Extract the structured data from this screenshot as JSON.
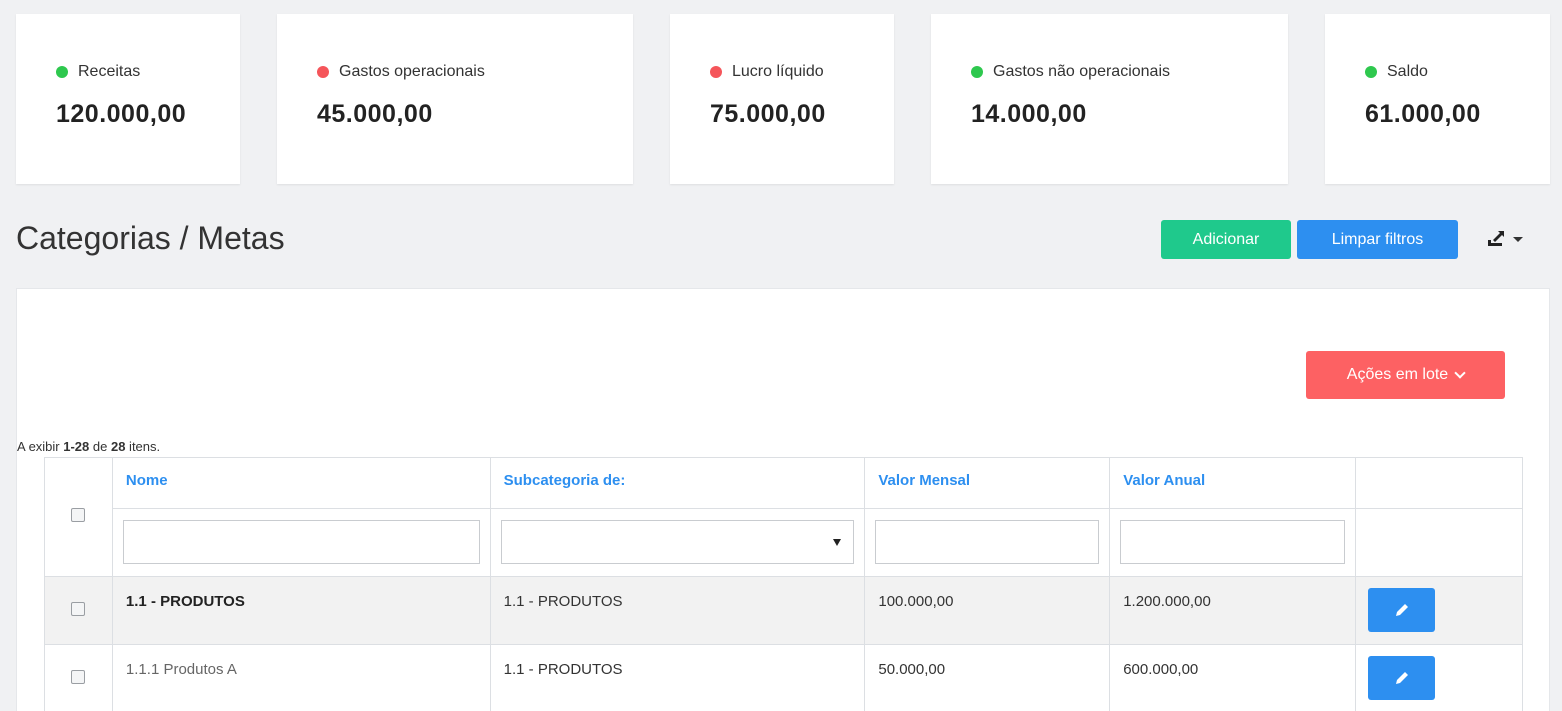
{
  "cards": [
    {
      "label": "Receitas",
      "value": "120.000,00",
      "dot": "#2ec84e"
    },
    {
      "label": "Gastos operacionais",
      "value": "45.000,00",
      "dot": "#f5555a"
    },
    {
      "label": "Lucro líquido",
      "value": "75.000,00",
      "dot": "#f5555a"
    },
    {
      "label": "Gastos não operacionais",
      "value": "14.000,00",
      "dot": "#2ec84e"
    },
    {
      "label": "Saldo",
      "value": "61.000,00",
      "dot": "#2ec84e"
    }
  ],
  "header": {
    "title": "Categorias / Metas",
    "add_label": "Adicionar",
    "clear_label": "Limpar filtros",
    "export_icon": "export-icon"
  },
  "panel": {
    "batch_label": "Ações em lote",
    "summary": {
      "prefix": "A exibir ",
      "range": "1-28",
      "middle": " de ",
      "total": "28",
      "suffix": " itens."
    }
  },
  "table": {
    "columns": [
      "Nome",
      "Subcategoria de:",
      "Valor Mensal",
      "Valor Anual"
    ],
    "rows": [
      {
        "name": "1.1 - PRODUTOS",
        "parent": "1.1 - PRODUTOS",
        "monthly": "100.000,00",
        "annual": "1.200.000,00"
      },
      {
        "name": "1.1.1 Produtos A",
        "parent": "1.1 - PRODUTOS",
        "monthly": "50.000,00",
        "annual": "600.000,00"
      }
    ]
  },
  "colors": {
    "green": "#1fc98c",
    "blue": "#2d8ff0",
    "red": "#fd6163"
  }
}
